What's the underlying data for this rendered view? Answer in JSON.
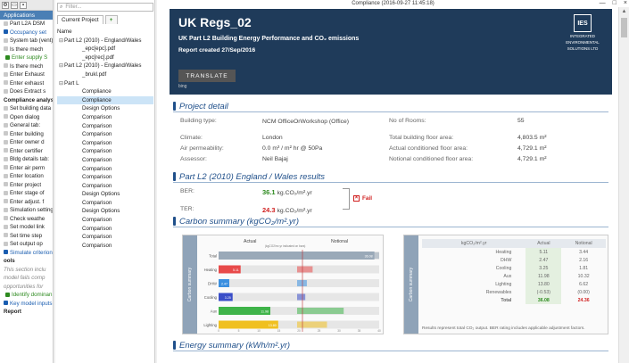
{
  "window": {
    "title": "Compliance  (2016-09-27 11:45:18)",
    "controls": {
      "minimize": "—",
      "maximize": "□",
      "close": "×"
    }
  },
  "left_panel": {
    "tab": "Applications",
    "items": [
      {
        "text": "Part L2A DSM",
        "style": "normal"
      },
      {
        "text": "Occupancy set",
        "style": "blue"
      },
      {
        "text": "System tab (vent)",
        "style": "normal"
      },
      {
        "text": "Is there mech",
        "style": "normal"
      },
      {
        "text": "Enter supply S",
        "style": "green"
      },
      {
        "text": "Is there mech",
        "style": "normal"
      },
      {
        "text": "Enter Exhaust",
        "style": "normal"
      },
      {
        "text": "Enter exhaust",
        "style": "normal"
      },
      {
        "text": "Does Extract s",
        "style": "normal"
      },
      {
        "text": "Compliance analysi",
        "style": "bold"
      },
      {
        "text": "Set building data",
        "style": "normal"
      },
      {
        "text": "Open dialog",
        "style": "normal"
      },
      {
        "text": "General tab:",
        "style": "normal"
      },
      {
        "text": "Enter building",
        "style": "normal"
      },
      {
        "text": "Enter owner d",
        "style": "normal"
      },
      {
        "text": "Enter certifier",
        "style": "normal"
      },
      {
        "text": "Bldg details tab:",
        "style": "normal"
      },
      {
        "text": "Enter air perm",
        "style": "normal"
      },
      {
        "text": "Enter location",
        "style": "normal"
      },
      {
        "text": "Enter project",
        "style": "normal"
      },
      {
        "text": "Enter stage of",
        "style": "normal"
      },
      {
        "text": "Enter adjust. f",
        "style": "normal"
      },
      {
        "text": "Simulation setting",
        "style": "normal"
      },
      {
        "text": "Check weathe",
        "style": "normal"
      },
      {
        "text": "Set model link",
        "style": "normal"
      },
      {
        "text": "Set time step",
        "style": "normal"
      },
      {
        "text": "Set output op",
        "style": "normal"
      },
      {
        "text": "Simulate criterion",
        "style": "blue"
      },
      {
        "text": "ools",
        "style": "bold"
      },
      {
        "text": "This section inclu",
        "style": "grey"
      },
      {
        "text": "model fails comp",
        "style": "grey"
      },
      {
        "text": "opportunities for",
        "style": "grey"
      },
      {
        "text": "Identify dominan",
        "style": "green"
      },
      {
        "text": "Key model inputs",
        "style": "blue"
      },
      {
        "text": "Report",
        "style": "bold"
      }
    ]
  },
  "project_tree": {
    "filter_placeholder": "Filter...",
    "tabs": {
      "current": "Current Project",
      "add": "+"
    },
    "header": "Name",
    "nodes": [
      {
        "text": "Part L2 (2010) - England/Wales",
        "indent": 0,
        "twisty": "⊟"
      },
      {
        "text": "_epc[epc].pdf",
        "indent": 2,
        "twisty": ""
      },
      {
        "text": "_epc[rec].pdf",
        "indent": 2,
        "twisty": ""
      },
      {
        "text": "Part L2 (2010) - England/Wales",
        "indent": 0,
        "twisty": "⊟"
      },
      {
        "text": "_brukl.pdf",
        "indent": 2,
        "twisty": ""
      },
      {
        "text": "Part L",
        "indent": 0,
        "twisty": "⊟"
      },
      {
        "text": "Compliance",
        "indent": 2,
        "twisty": ""
      },
      {
        "text": "Compliance",
        "indent": 2,
        "twisty": "",
        "selected": true
      },
      {
        "text": "Design Options",
        "indent": 2,
        "twisty": ""
      },
      {
        "text": "Comparison",
        "indent": 2,
        "twisty": ""
      },
      {
        "text": "Comparison",
        "indent": 2,
        "twisty": ""
      },
      {
        "text": "Comparison",
        "indent": 2,
        "twisty": ""
      },
      {
        "text": "Comparison",
        "indent": 2,
        "twisty": ""
      },
      {
        "text": "Comparison",
        "indent": 2,
        "twisty": ""
      },
      {
        "text": "Comparison",
        "indent": 2,
        "twisty": ""
      },
      {
        "text": "Comparison",
        "indent": 2,
        "twisty": ""
      },
      {
        "text": "Comparison",
        "indent": 2,
        "twisty": ""
      },
      {
        "text": "Comparison",
        "indent": 2,
        "twisty": ""
      },
      {
        "text": "Design Options",
        "indent": 2,
        "twisty": ""
      },
      {
        "text": "Comparison",
        "indent": 2,
        "twisty": ""
      },
      {
        "text": "Design Options",
        "indent": 2,
        "twisty": ""
      },
      {
        "text": "Comparison",
        "indent": 2,
        "twisty": ""
      },
      {
        "text": "Comparison",
        "indent": 2,
        "twisty": ""
      },
      {
        "text": "Comparison",
        "indent": 2,
        "twisty": ""
      },
      {
        "text": "Comparison",
        "indent": 2,
        "twisty": ""
      }
    ]
  },
  "report": {
    "title": "UK Regs_02",
    "subtitle": "UK Part L2 Building Energy Performance and CO₂ emissions",
    "date": "Report created 27/Sep/2016",
    "logo": {
      "mark": "IES",
      "line1": "INTEGRATED",
      "line2": "ENVIRONMENTAL",
      "line3": "SOLUTIONS LTD"
    },
    "translate": {
      "label": "TRANSLATE",
      "by": "bing"
    },
    "project_detail": {
      "heading": "Project detail",
      "building_type_label": "Building type:",
      "building_type_value": "NCM OfficeOrWorkshop (Office)",
      "climate_label": "Climate:",
      "climate_value": "London",
      "air_label": "Air permeability:",
      "air_value": "0.0 m³ / m² hr @ 50Pa",
      "assessor_label": "Assessor:",
      "assessor_value": "Neil Bajaj",
      "rooms_label": "No of Rooms:",
      "rooms_value": "55",
      "floor_label": "Total building floor area:",
      "floor_value": "4,803.5 m²",
      "actual_label": "Actual conditioned floor area:",
      "actual_value": "4,729.1 m²",
      "notional_label": "Notional conditioned floor area:",
      "notional_value": "4,729.1 m²"
    },
    "results": {
      "heading": "Part L2 (2010) England / Wales results",
      "ber_label": "BER:",
      "ber_value": "36.1",
      "ber_unit": " kg.CO₂/m².yr",
      "ter_label": "TER:",
      "ter_value": "24.3",
      "ter_unit": " kg.CO₂/m².yr",
      "status": "Fail"
    },
    "carbon": {
      "heading": "Carbon summary (kgCO₂/m².yr)",
      "side_label": "Carbon summary",
      "table": {
        "unit_header": "kgCO₂/m².yr",
        "actual_header": "Actual",
        "notional_header": "Notional",
        "rows": [
          {
            "label": "Heating",
            "actual": "5.11",
            "notional": "3.44"
          },
          {
            "label": "DHW",
            "actual": "2.47",
            "notional": "2.16"
          },
          {
            "label": "Cooling",
            "actual": "3.25",
            "notional": "1.81"
          },
          {
            "label": "Aux",
            "actual": "11.98",
            "notional": "10.32"
          },
          {
            "label": "Lighting",
            "actual": "13.80",
            "notional": "6.62"
          },
          {
            "label": "Renewables",
            "actual": "(-0.53)",
            "notional": "(0.00)"
          }
        ],
        "total": {
          "label": "Total",
          "actual": "36.08",
          "notional": "24.36"
        },
        "note": "Results represent total CO₂ output. BER rating includes applicable adjustment factors."
      }
    },
    "energy": {
      "heading": "Energy summary (kWh/m².yr)"
    }
  },
  "chart_data": {
    "type": "bar",
    "orientation": "horizontal",
    "categories": [
      "Total",
      "Heating",
      "DHW",
      "Cooling",
      "Aux",
      "Lighting"
    ],
    "series": [
      {
        "name": "Actual",
        "values": [
          36.08,
          5.11,
          2.47,
          3.25,
          11.98,
          13.8
        ]
      },
      {
        "name": "Notional",
        "values": [
          24.36,
          3.44,
          2.16,
          1.81,
          10.32,
          6.62
        ]
      }
    ],
    "title": "",
    "header_note": "(kgCO2/m².yr indicated on bars)",
    "colors": {
      "Total": "#9aa9b8",
      "Heating": "#e84a4a",
      "DHW": "#3a8fe0",
      "Cooling": "#3a4ec8",
      "Aux": "#3fb44a",
      "Lighting": "#f0c020"
    }
  }
}
